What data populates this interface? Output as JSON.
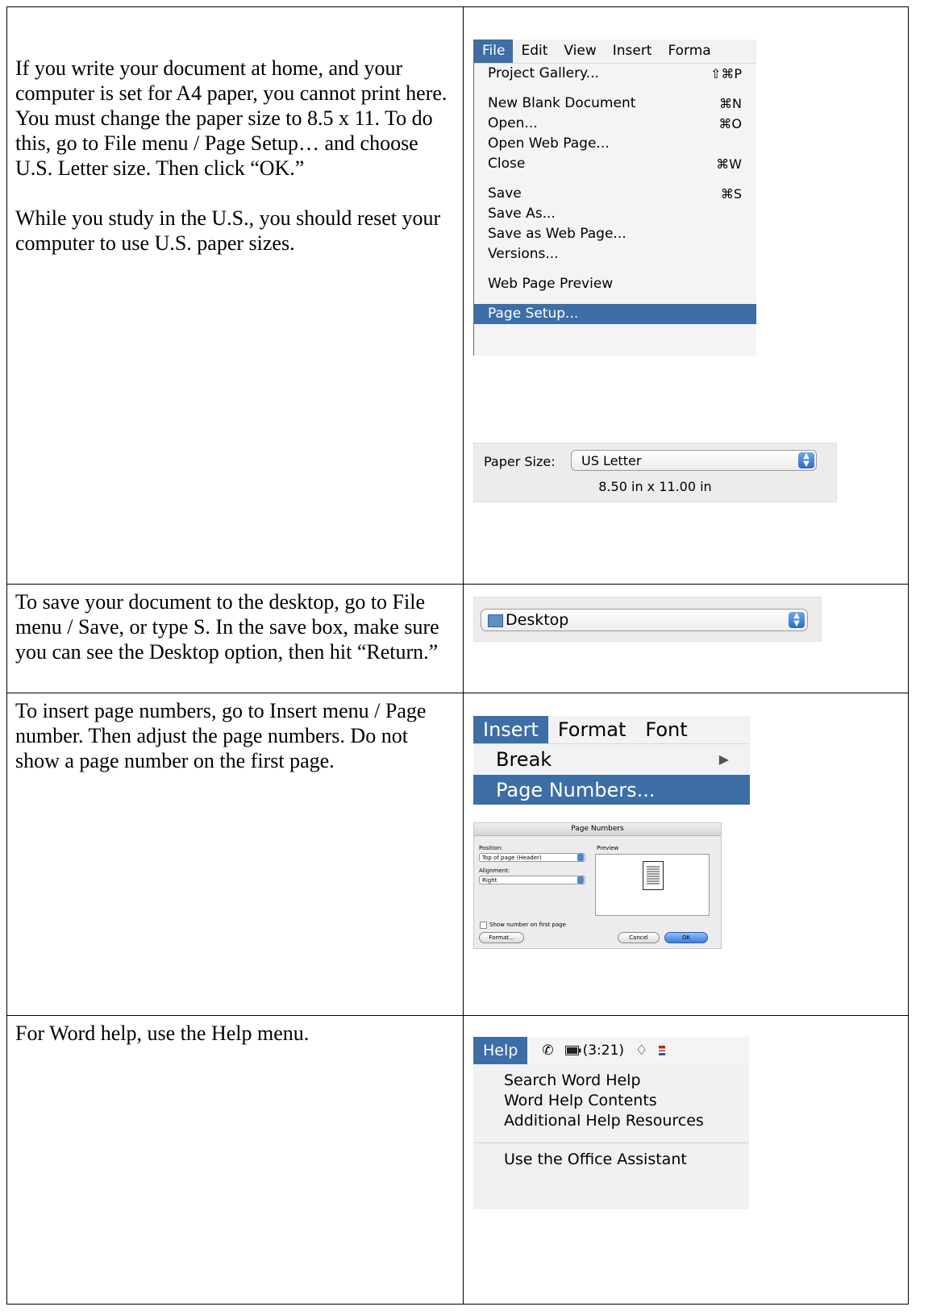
{
  "rows": [
    {
      "paragraphs": [
        "If you write your document at home, and your computer is set for A4 paper, you cannot print here. You must change the paper size to 8.5 x 11. To do this, go to File menu / Page Setup… and choose U.S. Letter size. Then click “OK.”",
        "While you study in the U.S., you should reset your computer to use U.S. paper sizes."
      ]
    },
    {
      "paragraphs": [
        "To save your document to the desktop, go to File menu / Save, or type  S. In the save box, make sure you can see the Desktop option, then hit “Return.”"
      ]
    },
    {
      "paragraphs": [
        "To insert page numbers, go to Insert menu / Page number. Then adjust the page numbers. Do not show a page number on the first page."
      ]
    },
    {
      "paragraphs": [
        "For Word help, use the Help menu."
      ]
    }
  ],
  "file_menu": {
    "bar": [
      "File",
      "Edit",
      "View",
      "Insert",
      "Forma"
    ],
    "items": [
      {
        "label": "Project Gallery...",
        "shortcut": "⇧⌘P"
      },
      {
        "label": "New Blank Document",
        "shortcut": "⌘N"
      },
      {
        "label": "Open...",
        "shortcut": "⌘O"
      },
      {
        "label": "Open Web Page...",
        "shortcut": ""
      },
      {
        "label": "Close",
        "shortcut": "⌘W"
      },
      {
        "label": "Save",
        "shortcut": "⌘S"
      },
      {
        "label": "Save As...",
        "shortcut": ""
      },
      {
        "label": "Save as Web Page...",
        "shortcut": ""
      },
      {
        "label": "Versions...",
        "shortcut": ""
      },
      {
        "label": "Web Page Preview",
        "shortcut": ""
      },
      {
        "label": "Page Setup...",
        "shortcut": ""
      }
    ]
  },
  "paper_size": {
    "label": "Paper Size:",
    "value": "US Letter",
    "dimensions": "8.50 in x 11.00 in"
  },
  "save_location": {
    "value": "Desktop"
  },
  "insert_menu": {
    "bar": [
      "Insert",
      "Format",
      "Font"
    ],
    "items": [
      {
        "label": "Break",
        "submenu": "▶"
      },
      {
        "label": "Page Numbers...",
        "submenu": ""
      }
    ]
  },
  "page_numbers_dialog": {
    "title": "Page Numbers",
    "position_label": "Position:",
    "position_value": "Top of page (Header)",
    "alignment_label": "Alignment:",
    "alignment_value": "Right",
    "preview_label": "Preview",
    "show_first_label": "Show number on first page",
    "show_first_checked": false,
    "format_button": "Format...",
    "cancel_button": "Cancel",
    "ok_button": "OK"
  },
  "help_menu": {
    "bar_label": "Help",
    "battery_time": "(3:21)",
    "items": [
      "Search Word Help",
      "Word Help Contents",
      "Additional Help Resources",
      "Use the Office Assistant"
    ]
  }
}
